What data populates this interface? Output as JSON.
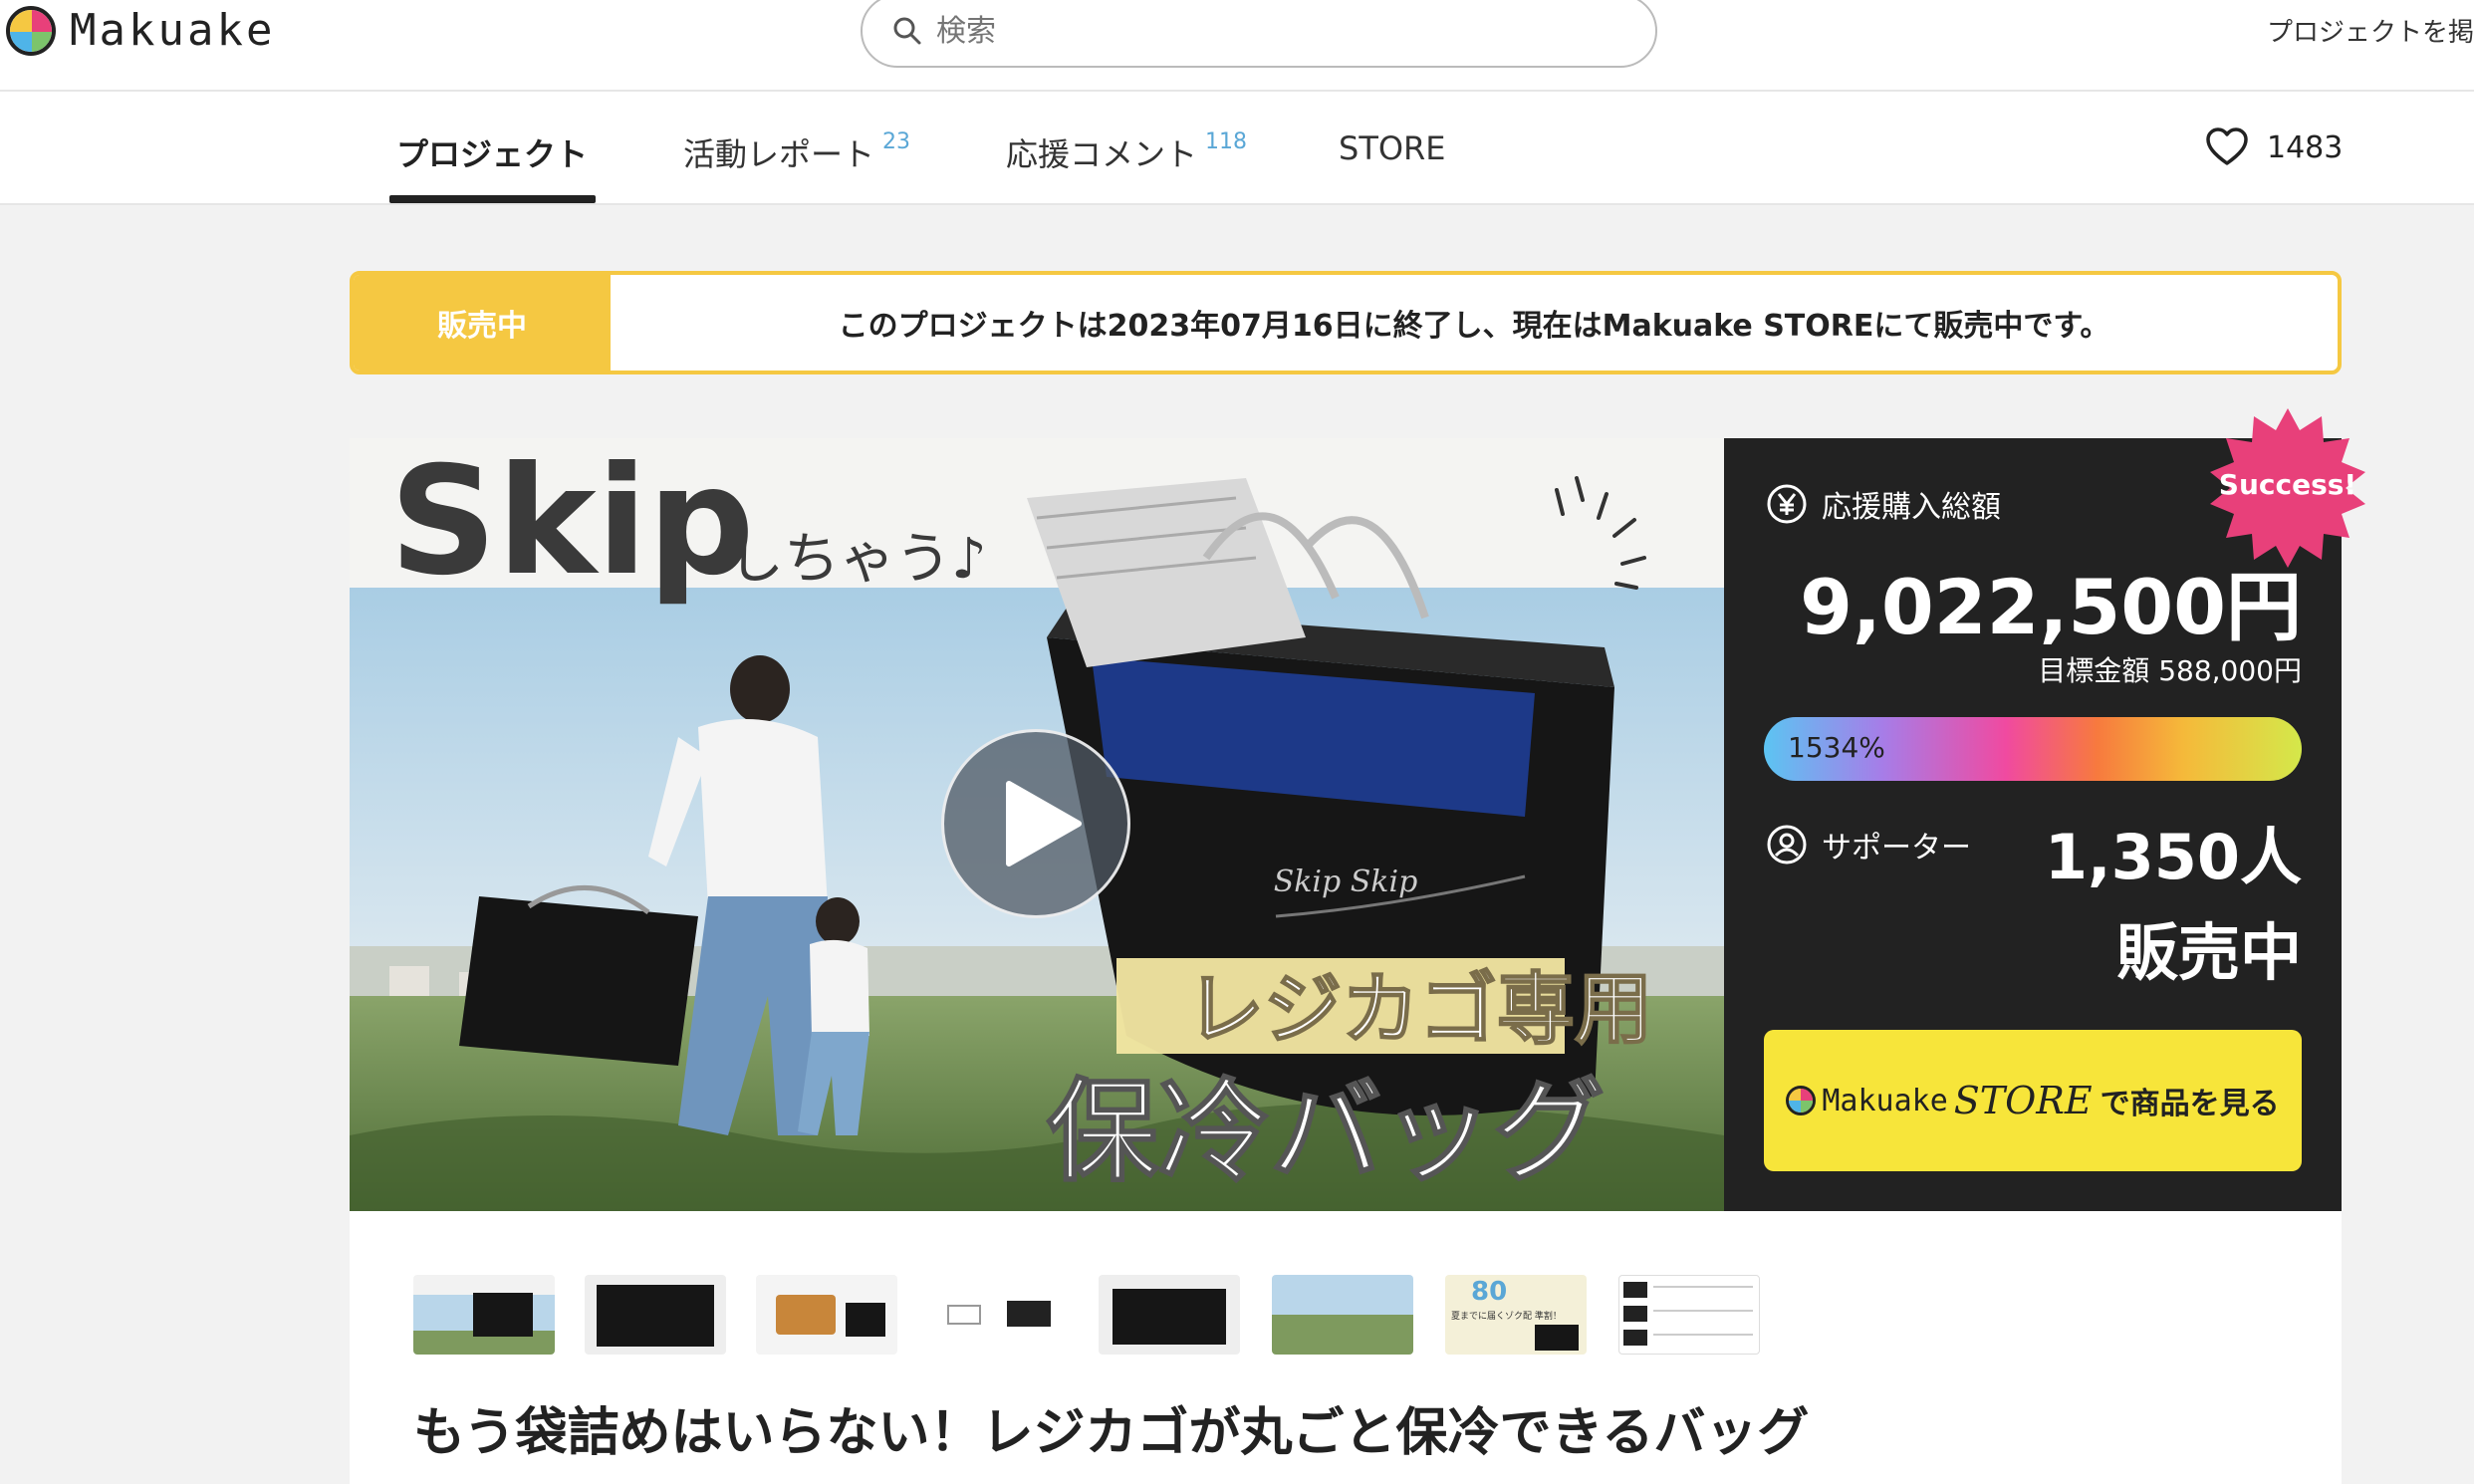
{
  "header": {
    "brand": "Makuake",
    "search_placeholder": "検索",
    "top_link": "プロジェクトを掲"
  },
  "tabs": [
    {
      "label": "プロジェクト",
      "count": ""
    },
    {
      "label": "活動レポート",
      "count": "23"
    },
    {
      "label": "応援コメント",
      "count": "118"
    },
    {
      "label": "STORE",
      "count": ""
    }
  ],
  "favorite_count": "1483",
  "notice": {
    "badge": "販売中",
    "text": "このプロジェクトは2023年07月16日に終了し、現在はMakuake STOREにて販売中です。"
  },
  "hero": {
    "headline_en": "Skip",
    "headline_jp": "しちゃう♪",
    "product_label": "レジカゴ専用",
    "product_name": "保冷バッグ",
    "bag_logo": "Skip Skip"
  },
  "stats": {
    "success_badge": "Success!",
    "funding_label": "応援購入総額",
    "funding_amount": "9,022,500円",
    "goal_label": "目標金額 588,000円",
    "progress_text": "1534%",
    "progress_percent": 1534,
    "supporters_label": "サポーター",
    "supporters_count": "1,350人",
    "status": "販売中",
    "store_button": {
      "brand": "Makuake",
      "store": "STORE",
      "suffix": "で商品を見る"
    }
  },
  "thumbnails": [
    {
      "name": "thumb-hero"
    },
    {
      "name": "thumb-bag-open"
    },
    {
      "name": "thumb-food-comparison"
    },
    {
      "name": "thumb-cart"
    },
    {
      "name": "thumb-bag-side"
    },
    {
      "name": "thumb-outdoor"
    },
    {
      "name": "thumb-discount"
    },
    {
      "name": "thumb-price-table"
    }
  ],
  "thumb_text": {
    "discount_value": "80",
    "discount_note": "夏までに届くゾク配 準割！"
  },
  "project_title": "もう袋詰めはいらない！レジカゴが丸ごと保冷できるバッグ",
  "colors": {
    "accent_yellow": "#f5c842",
    "button_yellow": "#f7e53a",
    "panel_bg": "#222222",
    "success_pink": "#e8407a",
    "tab_count_blue": "#5aa7d6"
  }
}
